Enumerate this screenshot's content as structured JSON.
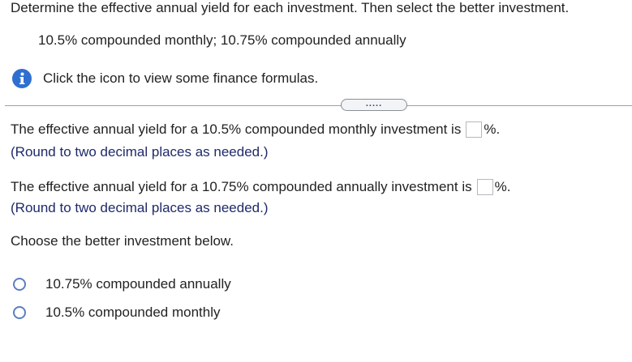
{
  "header": {
    "instruction": "Determine the effective annual yield for each investment. Then select the better investment.",
    "problem": "10.5% compounded monthly; 10.75% compounded annually"
  },
  "info": {
    "icon": "info-icon",
    "text": "Click the icon to view some finance formulas."
  },
  "expander": {
    "label": "....."
  },
  "questions": [
    {
      "prompt": "The effective annual yield for a 10.5% compounded monthly investment is",
      "answer_value": "",
      "suffix": "%.",
      "hint": "(Round to two decimal places as needed.)"
    },
    {
      "prompt": "The effective annual yield for a 10.75% compounded annually investment is",
      "answer_value": "",
      "suffix": "%.",
      "hint": "(Round to two decimal places as needed.)"
    }
  ],
  "choice": {
    "prompt": "Choose the better investment below.",
    "options": [
      {
        "label": "10.75% compounded annually"
      },
      {
        "label": "10.5% compounded monthly"
      }
    ]
  },
  "colors": {
    "info_icon": "#2f6fd0",
    "hint_text": "#1f2a6b",
    "radio_border": "#5b7fbf"
  }
}
